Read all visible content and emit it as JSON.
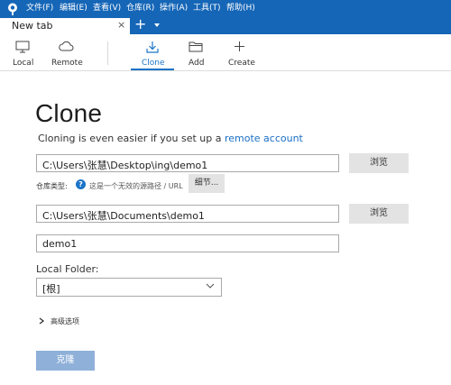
{
  "menu": {
    "items": [
      "文件(F)",
      "编辑(E)",
      "查看(V)",
      "仓库(R)",
      "操作(A)",
      "工具(T)",
      "帮助(H)"
    ]
  },
  "tabs": {
    "active_title": "New tab",
    "close_glyph": "×",
    "add_glyph": "+"
  },
  "toolbar": {
    "items": [
      {
        "label": "Local",
        "icon": "monitor-icon"
      },
      {
        "label": "Remote",
        "icon": "cloud-icon"
      },
      {
        "label": "Clone",
        "icon": "download-icon",
        "active": true
      },
      {
        "label": "Add",
        "icon": "folder-icon"
      },
      {
        "label": "Create",
        "icon": "plus-icon"
      }
    ]
  },
  "page": {
    "title": "Clone",
    "subtitle_prefix": "Cloning is even easier if you set up a",
    "subtitle_link": "remote account"
  },
  "form": {
    "source_path": "C:\\Users\\张慧\\Desktop\\ing\\demo1",
    "browse_label": "浏览",
    "repo_type_label": "仓库类型:",
    "help_glyph": "?",
    "repo_type_hint": "这是一个无效的源路径 / URL",
    "details_label": "细节...",
    "destination_path": "C:\\Users\\张慧\\Documents\\demo1",
    "name": "demo1",
    "local_folder_label": "Local Folder:",
    "local_folder_value": "[根]",
    "advanced_label": "高级选项",
    "clone_button": "克隆"
  },
  "colors": {
    "title_bar": "#1566b7",
    "accent": "#1a73c7",
    "clone_button": "#8fb0d8"
  }
}
